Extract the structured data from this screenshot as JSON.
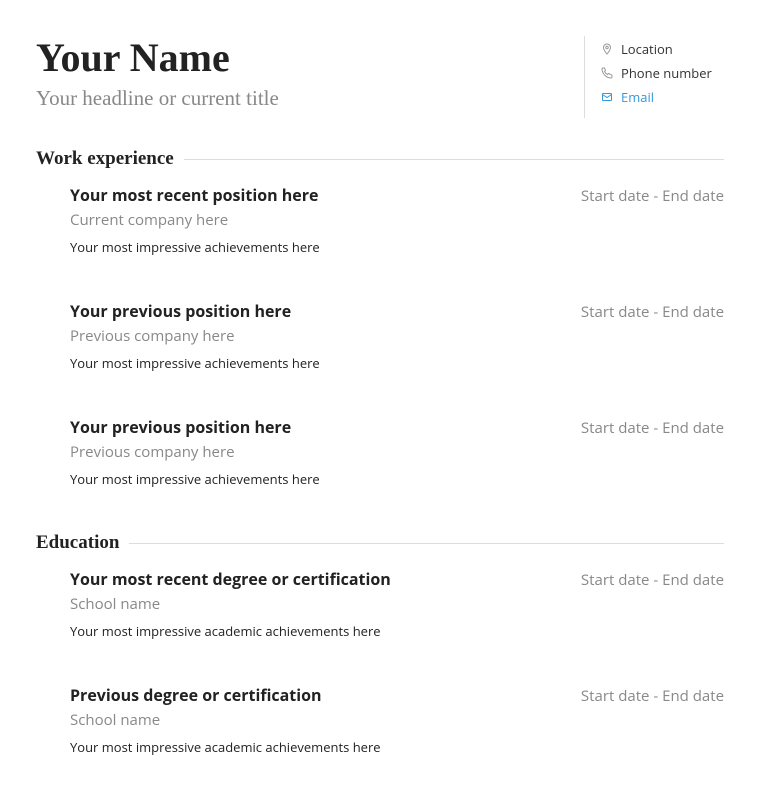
{
  "header": {
    "name": "Your Name",
    "headline": "Your headline or current title",
    "contact": {
      "location": "Location",
      "phone": "Phone number",
      "email": "Email"
    }
  },
  "sections": {
    "work": {
      "title": "Work experience",
      "entries": [
        {
          "title": "Your most recent position here",
          "dates": "Start date - End date",
          "sub": "Current company here",
          "desc": "Your most impressive achievements here"
        },
        {
          "title": "Your previous position here",
          "dates": "Start date - End date",
          "sub": "Previous company here",
          "desc": "Your most impressive achievements here"
        },
        {
          "title": "Your previous position here",
          "dates": "Start date - End date",
          "sub": "Previous company here",
          "desc": "Your most impressive achievements here"
        }
      ]
    },
    "education": {
      "title": "Education",
      "entries": [
        {
          "title": "Your most recent degree or certification",
          "dates": "Start date - End date",
          "sub": "School name",
          "desc": "Your most impressive academic achievements here"
        },
        {
          "title": "Previous degree or certification",
          "dates": "Start date - End date",
          "sub": "School name",
          "desc": "Your most impressive academic achievements here"
        }
      ]
    }
  }
}
